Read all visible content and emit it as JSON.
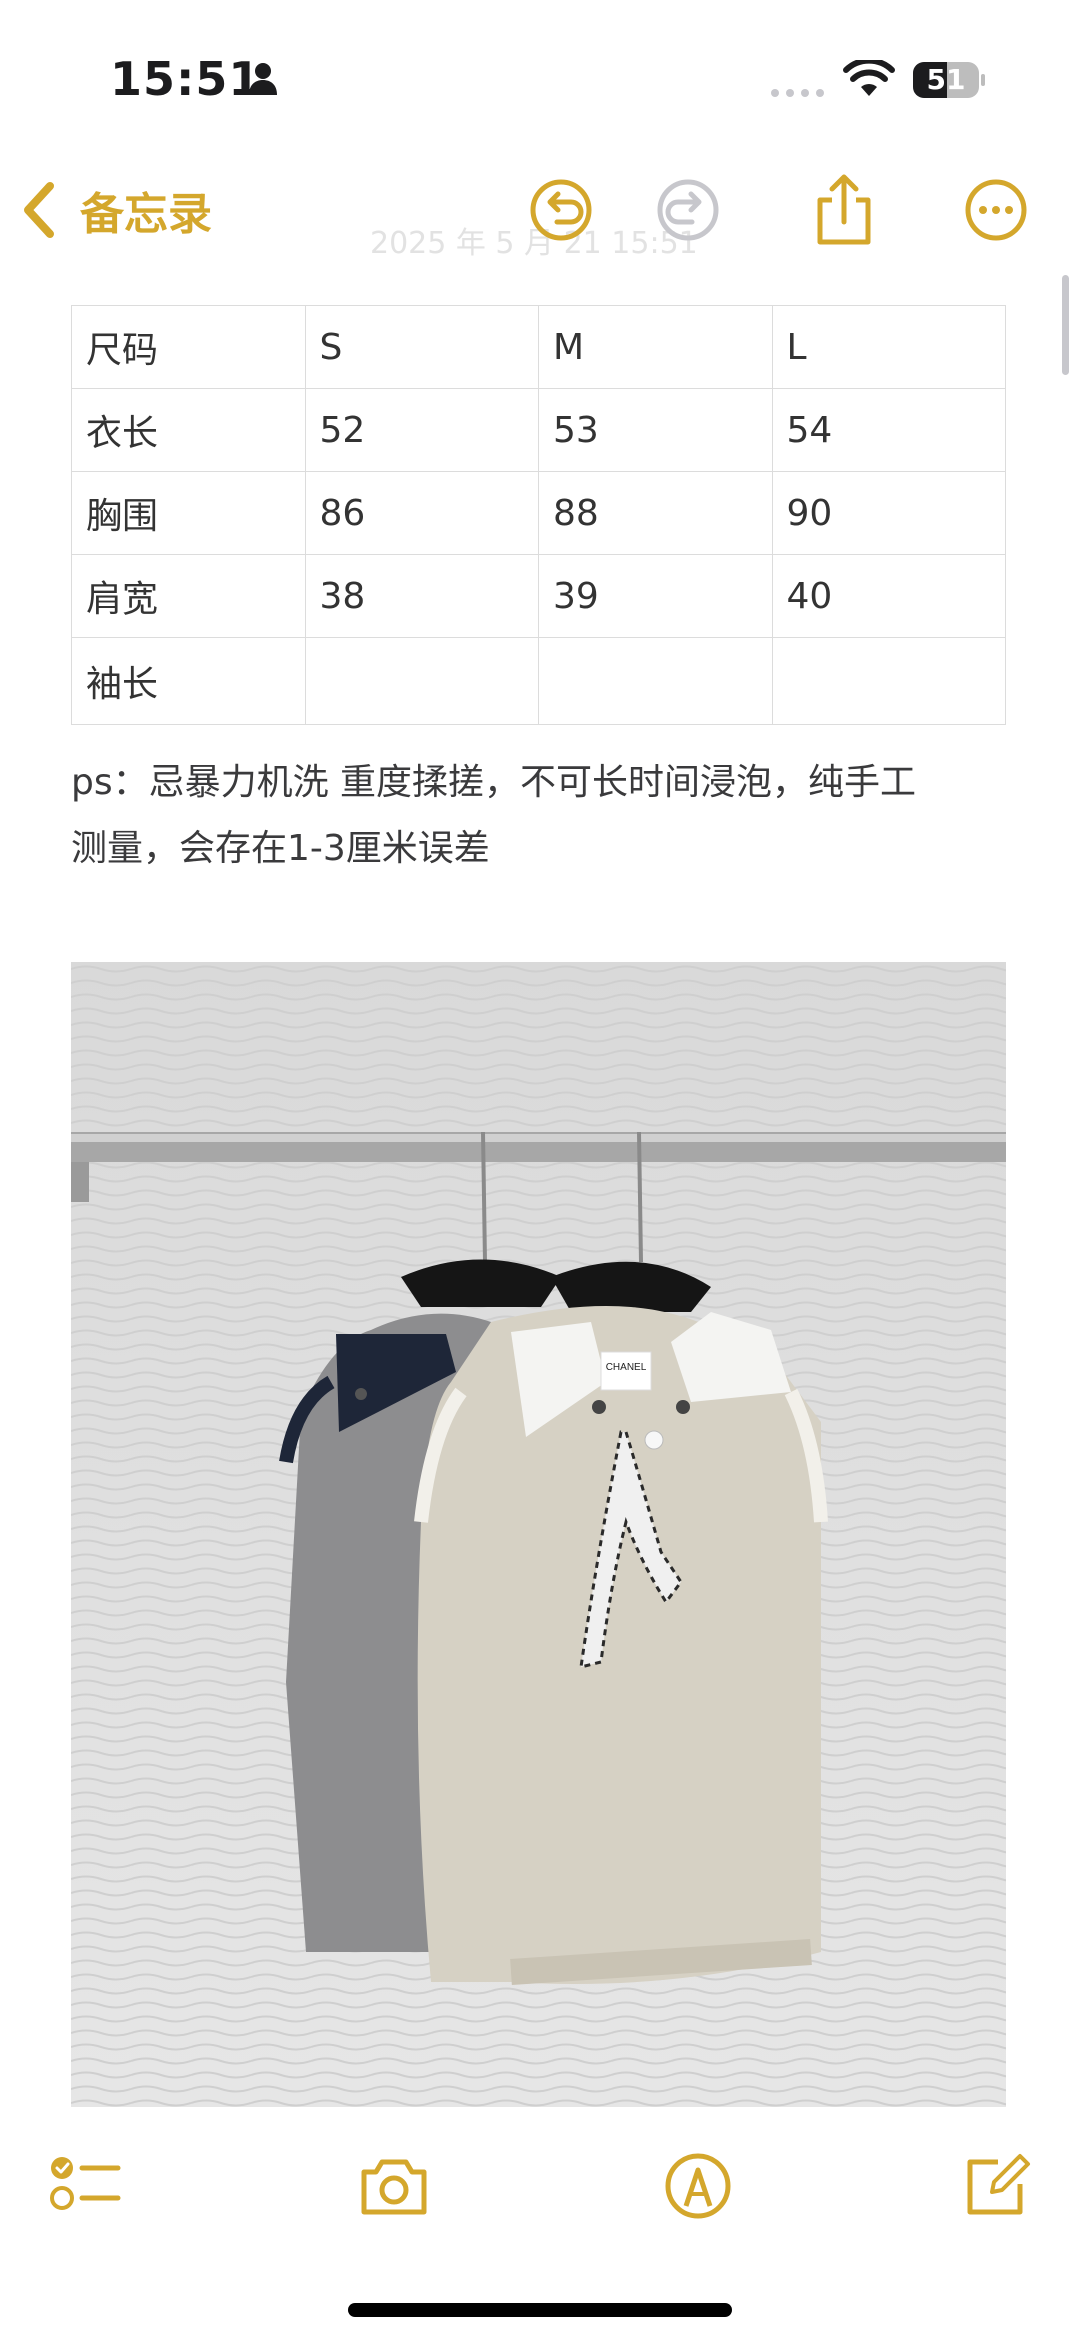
{
  "status_bar": {
    "time": "15:51",
    "battery_level": "51",
    "battery_fraction": 0.51
  },
  "nav": {
    "back_label": "备忘录",
    "faded_date": "2025 年 5 月 21  15:51",
    "icons": [
      "chevron-left-icon",
      "undo-icon",
      "redo-icon",
      "share-icon",
      "more-icon"
    ]
  },
  "table": {
    "headers": [
      "尺码",
      "S",
      "M",
      "L"
    ],
    "rows": [
      [
        "衣长",
        "52",
        "53",
        "54"
      ],
      [
        "胸围",
        "86",
        "88",
        "90"
      ],
      [
        "肩宽",
        "38",
        "39",
        "40"
      ],
      [
        "袖长",
        "",
        "",
        ""
      ]
    ]
  },
  "note": {
    "line1": "ps：忌暴力机洗 重度揉搓，不可长时间浸泡，纯手工",
    "line2": "测量，会存在1-3厘米误差"
  },
  "photo": {
    "label_text": "CHANEL"
  },
  "toolbar": {
    "icons": [
      "checklist-icon",
      "camera-icon",
      "markup-icon",
      "compose-icon"
    ]
  },
  "colors": {
    "accent": "#d4a72c",
    "text": "#1c1c1e",
    "border": "#dcdcdc"
  }
}
